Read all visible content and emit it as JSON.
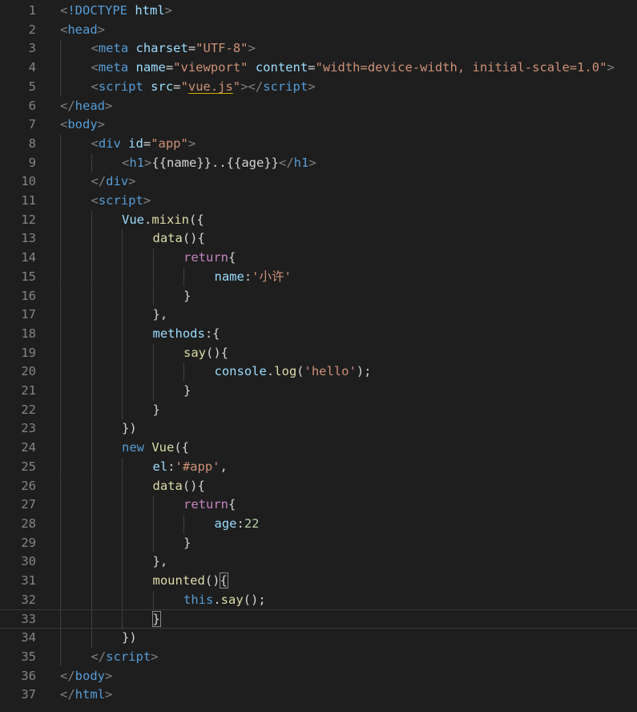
{
  "editor": {
    "colors": {
      "background": "#1e1e1e",
      "line_number": "#858585",
      "tag": "#569cd6",
      "attribute": "#9cdcfe",
      "string": "#ce9178",
      "keyword": "#c586c0",
      "function": "#dcdcaa",
      "number": "#b5cea8",
      "text": "#d4d4d4"
    },
    "current_line": 33,
    "lines": [
      {
        "n": "1",
        "indent": 0,
        "tokens": [
          [
            "<",
            "punc"
          ],
          [
            "!DOCTYPE",
            "tag"
          ],
          [
            " html",
            "attr"
          ],
          [
            ">",
            "punc"
          ]
        ]
      },
      {
        "n": "2",
        "indent": 0,
        "tokens": [
          [
            "<",
            "punc"
          ],
          [
            "head",
            "tag"
          ],
          [
            ">",
            "punc"
          ]
        ]
      },
      {
        "n": "3",
        "indent": 1,
        "tokens": [
          [
            "<",
            "punc"
          ],
          [
            "meta",
            "tag"
          ],
          [
            " charset",
            "attr"
          ],
          [
            "=",
            "text"
          ],
          [
            "\"UTF-8\"",
            "str"
          ],
          [
            ">",
            "punc"
          ]
        ]
      },
      {
        "n": "4",
        "indent": 1,
        "tokens": [
          [
            "<",
            "punc"
          ],
          [
            "meta",
            "tag"
          ],
          [
            " name",
            "attr"
          ],
          [
            "=",
            "text"
          ],
          [
            "\"viewport\"",
            "str"
          ],
          [
            " content",
            "attr"
          ],
          [
            "=",
            "text"
          ],
          [
            "\"width=device-width, initial-scale=1.0\"",
            "str"
          ],
          [
            ">",
            "punc"
          ]
        ]
      },
      {
        "n": "5",
        "indent": 1,
        "tokens": [
          [
            "<",
            "punc"
          ],
          [
            "script",
            "tag"
          ],
          [
            " src",
            "attr"
          ],
          [
            "=",
            "text"
          ],
          [
            "\"",
            "str"
          ],
          [
            "vue.js",
            "str",
            "underline"
          ],
          [
            "\"",
            "str"
          ],
          [
            "></",
            "punc"
          ],
          [
            "script",
            "tag"
          ],
          [
            ">",
            "punc"
          ]
        ]
      },
      {
        "n": "6",
        "indent": 0,
        "tokens": [
          [
            "</",
            "punc"
          ],
          [
            "head",
            "tag"
          ],
          [
            ">",
            "punc"
          ]
        ]
      },
      {
        "n": "7",
        "indent": 0,
        "tokens": [
          [
            "<",
            "punc"
          ],
          [
            "body",
            "tag"
          ],
          [
            ">",
            "punc"
          ]
        ]
      },
      {
        "n": "8",
        "indent": 1,
        "tokens": [
          [
            "<",
            "punc"
          ],
          [
            "div",
            "tag"
          ],
          [
            " id",
            "attr"
          ],
          [
            "=",
            "text"
          ],
          [
            "\"app\"",
            "str"
          ],
          [
            ">",
            "punc"
          ]
        ]
      },
      {
        "n": "9",
        "indent": 2,
        "tokens": [
          [
            "<",
            "punc"
          ],
          [
            "h1",
            "tag"
          ],
          [
            ">",
            "punc"
          ],
          [
            "{{name}}..{{age}}",
            "text"
          ],
          [
            "</",
            "punc"
          ],
          [
            "h1",
            "tag"
          ],
          [
            ">",
            "punc"
          ]
        ]
      },
      {
        "n": "10",
        "indent": 1,
        "tokens": [
          [
            "</",
            "punc"
          ],
          [
            "div",
            "tag"
          ],
          [
            ">",
            "punc"
          ]
        ]
      },
      {
        "n": "11",
        "indent": 1,
        "tokens": [
          [
            "<",
            "punc"
          ],
          [
            "script",
            "tag"
          ],
          [
            ">",
            "punc"
          ]
        ]
      },
      {
        "n": "12",
        "indent": 2,
        "tokens": [
          [
            "Vue",
            "attr"
          ],
          [
            ".",
            "text"
          ],
          [
            "mixin",
            "fn"
          ],
          [
            "({",
            "text"
          ]
        ]
      },
      {
        "n": "13",
        "indent": 3,
        "tokens": [
          [
            "data",
            "fn"
          ],
          [
            "(){",
            "text"
          ]
        ]
      },
      {
        "n": "14",
        "indent": 4,
        "tokens": [
          [
            "return",
            "kw"
          ],
          [
            "{",
            "text"
          ]
        ]
      },
      {
        "n": "15",
        "indent": 5,
        "tokens": [
          [
            "name",
            "attr"
          ],
          [
            ":",
            "text"
          ],
          [
            "'小许'",
            "str"
          ]
        ]
      },
      {
        "n": "16",
        "indent": 4,
        "tokens": [
          [
            "}",
            "text"
          ]
        ]
      },
      {
        "n": "17",
        "indent": 3,
        "tokens": [
          [
            "},",
            "text"
          ]
        ]
      },
      {
        "n": "18",
        "indent": 3,
        "tokens": [
          [
            "methods",
            "attr"
          ],
          [
            ":{",
            "text"
          ]
        ]
      },
      {
        "n": "19",
        "indent": 4,
        "tokens": [
          [
            "say",
            "fn"
          ],
          [
            "(){",
            "text"
          ]
        ]
      },
      {
        "n": "20",
        "indent": 5,
        "tokens": [
          [
            "console",
            "attr"
          ],
          [
            ".",
            "text"
          ],
          [
            "log",
            "fn"
          ],
          [
            "(",
            "text"
          ],
          [
            "'hello'",
            "str"
          ],
          [
            ");",
            "text"
          ]
        ]
      },
      {
        "n": "21",
        "indent": 4,
        "tokens": [
          [
            "}",
            "text"
          ]
        ]
      },
      {
        "n": "22",
        "indent": 3,
        "tokens": [
          [
            "}",
            "text"
          ]
        ]
      },
      {
        "n": "23",
        "indent": 2,
        "tokens": [
          [
            "})",
            "text"
          ]
        ]
      },
      {
        "n": "24",
        "indent": 2,
        "tokens": [
          [
            "new",
            "ctrl"
          ],
          [
            " ",
            "text"
          ],
          [
            "Vue",
            "fn"
          ],
          [
            "({",
            "text"
          ]
        ]
      },
      {
        "n": "25",
        "indent": 3,
        "tokens": [
          [
            "el",
            "attr"
          ],
          [
            ":",
            "text"
          ],
          [
            "'#app'",
            "str"
          ],
          [
            ",",
            "text"
          ]
        ]
      },
      {
        "n": "26",
        "indent": 3,
        "tokens": [
          [
            "data",
            "fn"
          ],
          [
            "(){",
            "text"
          ]
        ]
      },
      {
        "n": "27",
        "indent": 4,
        "tokens": [
          [
            "return",
            "kw"
          ],
          [
            "{",
            "text"
          ]
        ]
      },
      {
        "n": "28",
        "indent": 5,
        "tokens": [
          [
            "age",
            "attr"
          ],
          [
            ":",
            "text"
          ],
          [
            "22",
            "num"
          ]
        ]
      },
      {
        "n": "29",
        "indent": 4,
        "tokens": [
          [
            "}",
            "text"
          ]
        ]
      },
      {
        "n": "30",
        "indent": 3,
        "tokens": [
          [
            "},",
            "text"
          ]
        ]
      },
      {
        "n": "31",
        "indent": 3,
        "tokens": [
          [
            "mounted",
            "fn"
          ],
          [
            "()",
            "text"
          ],
          [
            "{",
            "text",
            "bracket"
          ]
        ]
      },
      {
        "n": "32",
        "indent": 4,
        "tokens": [
          [
            "this",
            "ctrl"
          ],
          [
            ".",
            "text"
          ],
          [
            "say",
            "fn"
          ],
          [
            "();",
            "text"
          ]
        ]
      },
      {
        "n": "33",
        "indent": 3,
        "tokens": [
          [
            "}",
            "text",
            "bracket"
          ]
        ]
      },
      {
        "n": "34",
        "indent": 2,
        "tokens": [
          [
            "})",
            "text"
          ]
        ]
      },
      {
        "n": "35",
        "indent": 1,
        "tokens": [
          [
            "</",
            "punc"
          ],
          [
            "script",
            "tag"
          ],
          [
            ">",
            "punc"
          ]
        ]
      },
      {
        "n": "36",
        "indent": 0,
        "tokens": [
          [
            "</",
            "punc"
          ],
          [
            "body",
            "tag"
          ],
          [
            ">",
            "punc"
          ]
        ]
      },
      {
        "n": "37",
        "indent": 0,
        "tokens": [
          [
            "</",
            "punc"
          ],
          [
            "html",
            "tag"
          ],
          [
            ">",
            "punc"
          ]
        ]
      }
    ]
  }
}
